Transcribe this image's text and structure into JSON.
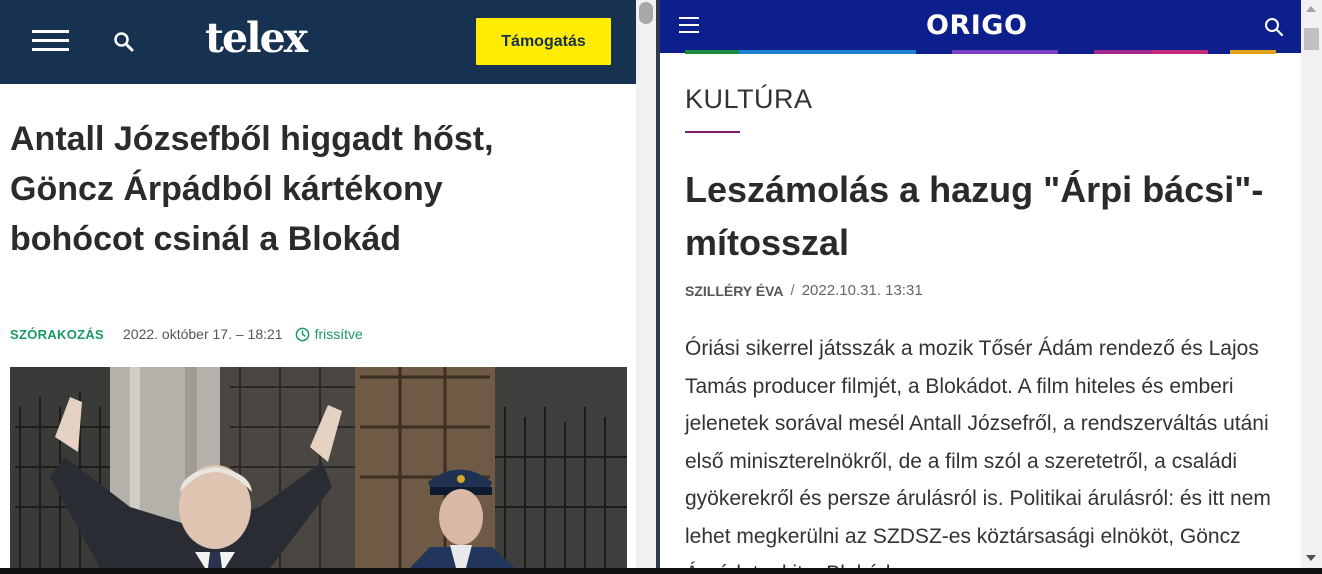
{
  "telex": {
    "logo": "telex",
    "support_label": "Támogatás",
    "headline": "Antall Józsefből higgadt hőst, Göncz Árpádból kártékony bohócot csinál a Blokád",
    "category": "SZÓRAKOZÁS",
    "date": "2022. október 17. – 18:21",
    "updated_label": "frissítve",
    "colors": {
      "header": "#163250",
      "support_bg": "#ffec00",
      "accent": "#1a9966"
    },
    "icons": [
      "hamburger-menu-icon",
      "search-icon",
      "clock-icon"
    ]
  },
  "origo": {
    "logo": "ORIGO",
    "section": "KULTÚRA",
    "headline": "Leszámolás a hazug \"Árpi bácsi\"-mítosszal",
    "author": "SZILLÉRY ÉVA",
    "separator": "/",
    "date": "2022.10.31. 13:31",
    "body": "Óriási sikerrel játsszák a mozik Tősér Ádám rendező és Lajos Tamás producer filmjét, a Blokádot. A film hiteles és emberi jelenetek sorával mesél Antall Józsefről, a rendszerváltás utáni első miniszterelnökről, de a film szól a szeretetről, a családi gyökerekről és persze árulásról is. Politikai árulásról: és itt nem lehet megkerülni az SZDSZ-es köztársasági elnököt, Göncz Árpádot, akit a Blokád",
    "colors": {
      "header": "#0d1f8c",
      "section_rule": "#7a1f70"
    },
    "icons": [
      "hamburger-menu-icon",
      "search-icon"
    ]
  }
}
